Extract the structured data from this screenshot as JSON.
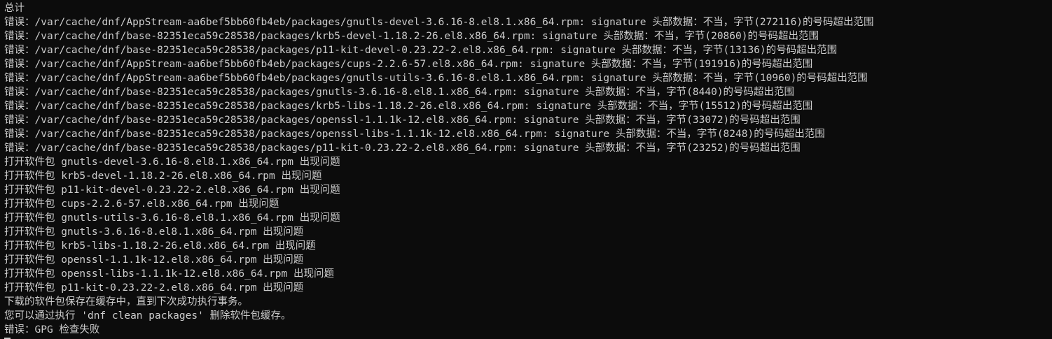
{
  "terminal": {
    "lines": [
      "总计",
      "错误：/var/cache/dnf/AppStream-aa6bef5bb60fb4eb/packages/gnutls-devel-3.6.16-8.el8.1.x86_64.rpm: signature 头部数据：不当，字节(272116)的号码超出范围",
      "错误：/var/cache/dnf/base-82351eca59c28538/packages/krb5-devel-1.18.2-26.el8.x86_64.rpm: signature 头部数据：不当，字节(20860)的号码超出范围",
      "错误：/var/cache/dnf/base-82351eca59c28538/packages/p11-kit-devel-0.23.22-2.el8.x86_64.rpm: signature 头部数据：不当，字节(13136)的号码超出范围",
      "错误：/var/cache/dnf/AppStream-aa6bef5bb60fb4eb/packages/cups-2.2.6-57.el8.x86_64.rpm: signature 头部数据：不当，字节(191916)的号码超出范围",
      "错误：/var/cache/dnf/AppStream-aa6bef5bb60fb4eb/packages/gnutls-utils-3.6.16-8.el8.1.x86_64.rpm: signature 头部数据：不当，字节(10960)的号码超出范围",
      "错误：/var/cache/dnf/base-82351eca59c28538/packages/gnutls-3.6.16-8.el8.1.x86_64.rpm: signature 头部数据：不当，字节(8440)的号码超出范围",
      "错误：/var/cache/dnf/base-82351eca59c28538/packages/krb5-libs-1.18.2-26.el8.x86_64.rpm: signature 头部数据：不当，字节(15512)的号码超出范围",
      "错误：/var/cache/dnf/base-82351eca59c28538/packages/openssl-1.1.1k-12.el8.x86_64.rpm: signature 头部数据：不当，字节(33072)的号码超出范围",
      "错误：/var/cache/dnf/base-82351eca59c28538/packages/openssl-libs-1.1.1k-12.el8.x86_64.rpm: signature 头部数据：不当，字节(8248)的号码超出范围",
      "错误：/var/cache/dnf/base-82351eca59c28538/packages/p11-kit-0.23.22-2.el8.x86_64.rpm: signature 头部数据：不当，字节(23252)的号码超出范围",
      "打开软件包 gnutls-devel-3.6.16-8.el8.1.x86_64.rpm 出现问题",
      "打开软件包 krb5-devel-1.18.2-26.el8.x86_64.rpm 出现问题",
      "打开软件包 p11-kit-devel-0.23.22-2.el8.x86_64.rpm 出现问题",
      "打开软件包 cups-2.2.6-57.el8.x86_64.rpm 出现问题",
      "打开软件包 gnutls-utils-3.6.16-8.el8.1.x86_64.rpm 出现问题",
      "打开软件包 gnutls-3.6.16-8.el8.1.x86_64.rpm 出现问题",
      "打开软件包 krb5-libs-1.18.2-26.el8.x86_64.rpm 出现问题",
      "打开软件包 openssl-1.1.1k-12.el8.x86_64.rpm 出现问题",
      "打开软件包 openssl-libs-1.1.1k-12.el8.x86_64.rpm 出现问题",
      "打开软件包 p11-kit-0.23.22-2.el8.x86_64.rpm 出现问题",
      "下载的软件包保存在缓存中，直到下次成功执行事务。",
      "您可以通过执行 'dnf clean packages' 删除软件包缓存。",
      "错误：GPG 检查失败"
    ]
  },
  "colors": {
    "background": "#0c0c0c",
    "text": "#cccccc"
  }
}
